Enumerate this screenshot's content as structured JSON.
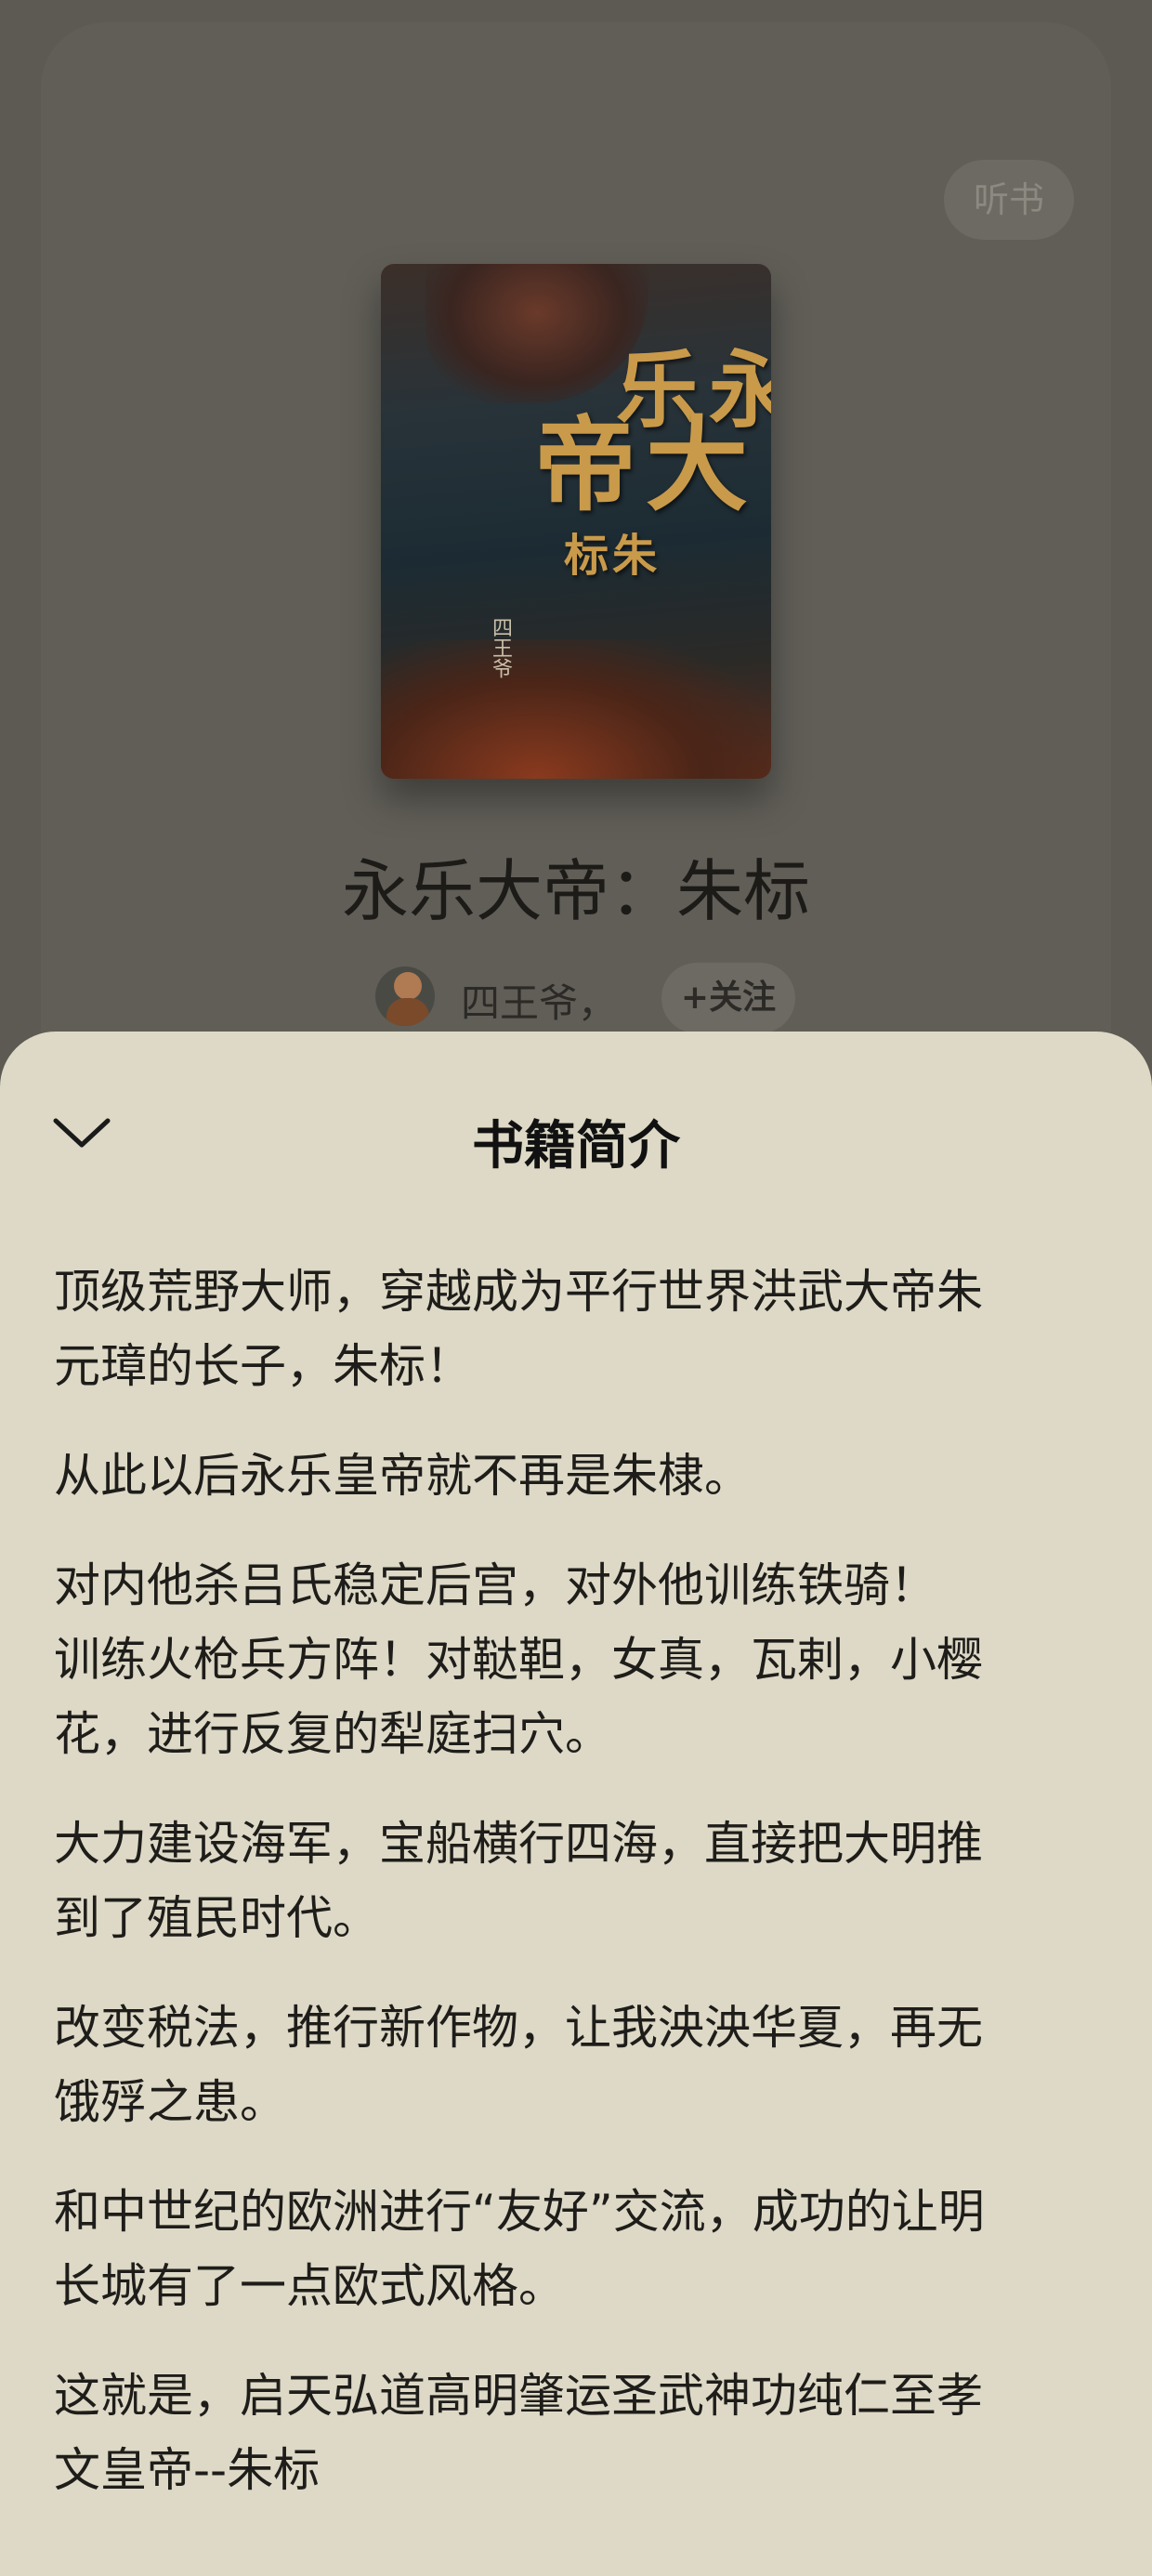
{
  "background": {
    "listen_label": "听书",
    "cover": {
      "title_a": "永乐",
      "title_b": "大帝",
      "title_c": "朱标",
      "author": "四王爷"
    },
    "book_title": "永乐大帝：朱标",
    "author_name": "四王爷，",
    "follow_label": "+关注"
  },
  "sheet": {
    "title": "书籍简介",
    "paragraphs": [
      [
        "顶级荒野大师，穿越成为平行世界洪武大帝朱",
        "元璋的长子，朱标！"
      ],
      [
        "从此以后永乐皇帝就不再是朱棣。"
      ],
      [
        "对内他杀吕氏稳定后宫，对外他训练铁骑！",
        "训练火枪兵方阵！对鞑靼，女真，瓦剌，小樱",
        "花，进行反复的犁庭扫穴。"
      ],
      [
        "大力建设海军，宝船横行四海，直接把大明推",
        "到了殖民时代。"
      ],
      [
        "改变税法，推行新作物，让我泱泱华夏，再无",
        "饿殍之患。"
      ],
      [
        "和中世纪的欧洲进行“友好”交流，成功的让明",
        "长城有了一点欧式风格。"
      ],
      [
        "这就是，启天弘道高明肇运圣武神功纯仁至孝",
        "文皇帝--朱标"
      ]
    ]
  },
  "colors": {
    "overlay_bg": "#5c5a53",
    "sheet_bg": "#ddd9c6",
    "text": "#1e1d1a"
  }
}
